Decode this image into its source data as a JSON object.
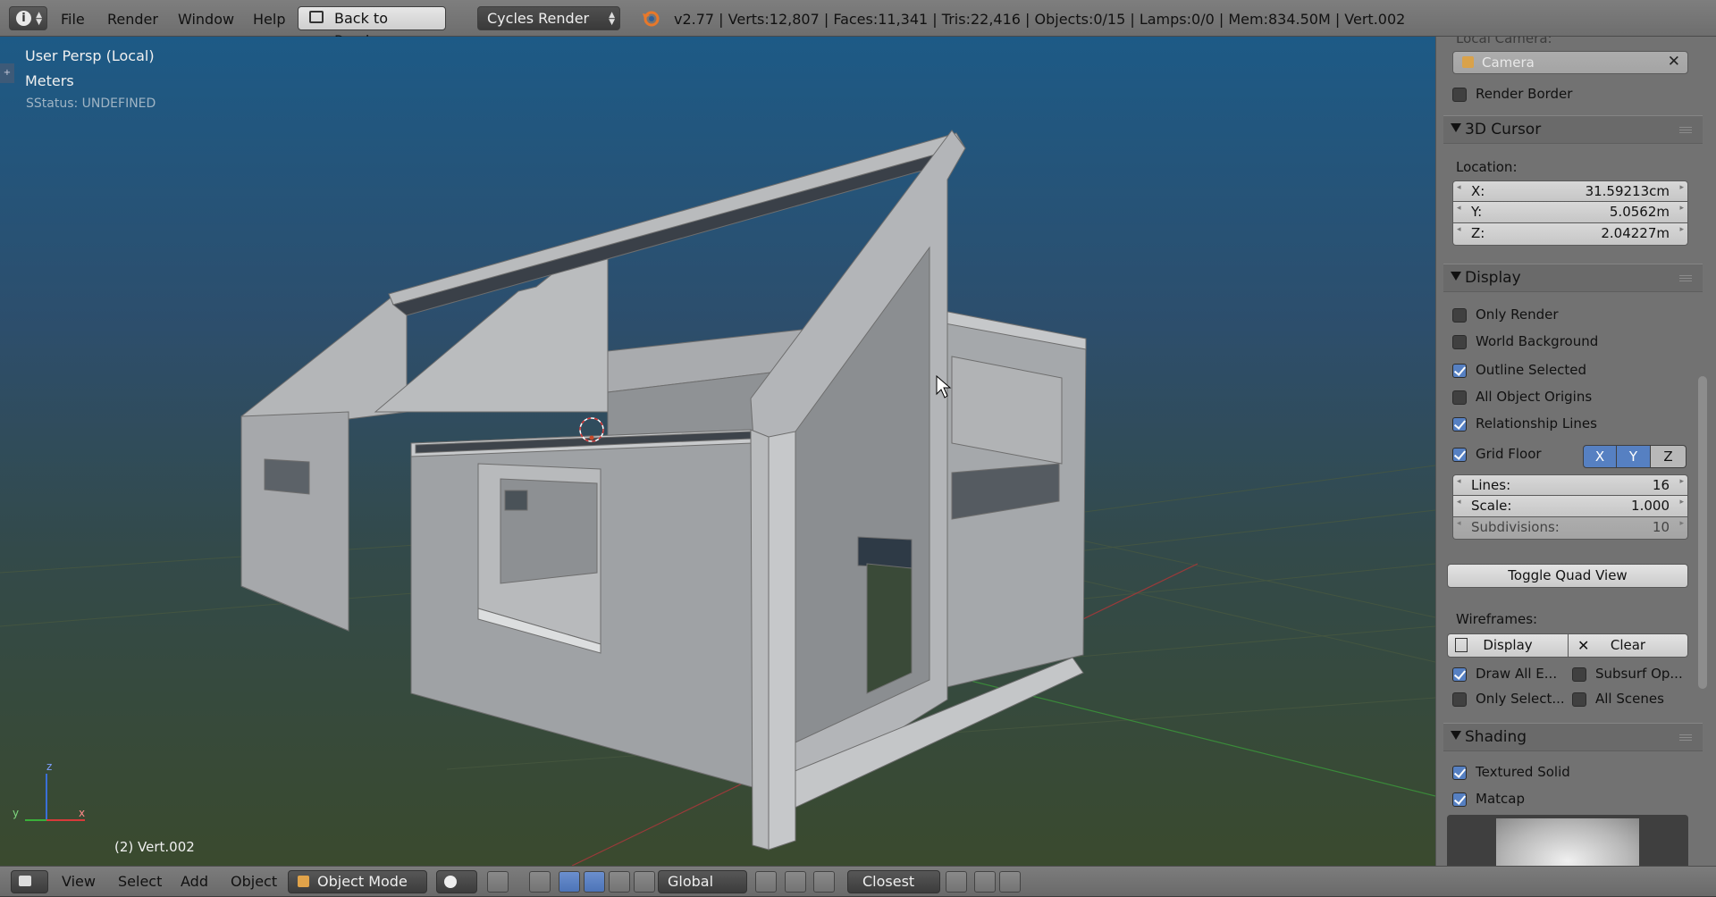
{
  "topbar": {
    "menus": [
      "File",
      "Render",
      "Window",
      "Help"
    ],
    "back_button": "Back to Previous",
    "render_engine": "Cycles Render",
    "stats": "v2.77 | Verts:12,807 | Faces:11,341 | Tris:22,416 | Objects:0/15 | Lamps:0/0 | Mem:834.50M | Vert.002"
  },
  "viewport": {
    "view_name": "User Persp (Local)",
    "units": "Meters",
    "status": "SStatus: UNDEFINED",
    "selected_object": "(2) Vert.002",
    "axis_z": "z",
    "axis_y": "y",
    "axis_x": "x"
  },
  "properties": {
    "local_camera_label": "Local Camera:",
    "camera_value": "Camera",
    "render_border": "Render Border",
    "cursor": {
      "title": "3D Cursor",
      "location_label": "Location:",
      "x_label": "X:",
      "x_value": "31.59213cm",
      "y_label": "Y:",
      "y_value": "5.0562m",
      "z_label": "Z:",
      "z_value": "2.04227m"
    },
    "display": {
      "title": "Display",
      "only_render": "Only Render",
      "world_background": "World Background",
      "outline_selected": "Outline Selected",
      "all_object_origins": "All Object Origins",
      "relationship_lines": "Relationship Lines",
      "grid_floor": "Grid Floor",
      "axis_x": "X",
      "axis_y": "Y",
      "axis_z": "Z",
      "lines_label": "Lines:",
      "lines_value": "16",
      "scale_label": "Scale:",
      "scale_value": "1.000",
      "subdiv_label": "Subdivisions:",
      "subdiv_value": "10",
      "toggle_quad": "Toggle Quad View",
      "wireframes_label": "Wireframes:",
      "wf_display": "Display",
      "wf_clear": "Clear",
      "draw_all_edges": "Draw All E...",
      "subsurf_optimal": "Subsurf Op...",
      "only_selected": "Only Select...",
      "all_scenes": "All Scenes"
    },
    "shading": {
      "title": "Shading",
      "textured_solid": "Textured Solid",
      "matcap": "Matcap"
    }
  },
  "bottombar": {
    "menus": [
      "View",
      "Select",
      "Add",
      "Object"
    ],
    "mode": "Object Mode",
    "orientation": "Global",
    "snap_target": "Closest"
  },
  "colors": {
    "accent": "#5680c2",
    "panel": "#727272",
    "header": "#6e6e6e"
  }
}
